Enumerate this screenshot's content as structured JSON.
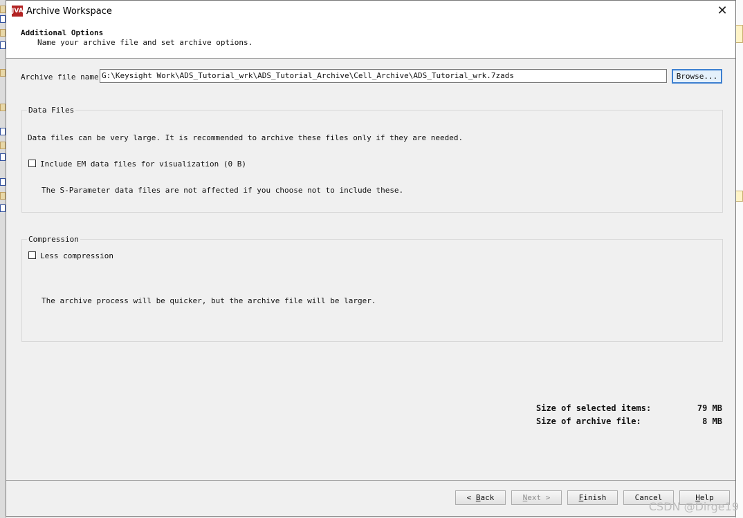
{
  "window": {
    "title": "Archive Workspace",
    "icon_text": "JVA",
    "close_glyph": "✕"
  },
  "header": {
    "title": "Additional Options",
    "subtitle": "Name your archive file and set archive options."
  },
  "archive": {
    "label": "Archive file name:",
    "value": "G:\\Keysight Work\\ADS_Tutorial_wrk\\ADS_Tutorial_Archive\\Cell_Archive\\ADS_Tutorial_wrk.7zads",
    "browse_label": "Browse..."
  },
  "data_files": {
    "group_title": "Data Files",
    "description": "Data files can be very large. It is recommended to archive these files only if they are needed.",
    "checkbox_label": "Include EM data files for visualization (0 B)",
    "checkbox_checked": false,
    "note": "The S-Parameter data files are not affected if you choose not to include these."
  },
  "compression": {
    "group_title": "Compression",
    "checkbox_label": "Less compression",
    "checkbox_checked": false,
    "note": "The archive process will be quicker, but the archive file will be larger."
  },
  "summary": {
    "selected_label": "Size of selected items:",
    "selected_value": "79 MB",
    "archive_label": "Size of archive file:",
    "archive_value": "8 MB"
  },
  "buttons": {
    "back": {
      "mnemonic": "B",
      "rest": "ack",
      "prefix": "< "
    },
    "next": {
      "mnemonic": "N",
      "rest": "ext",
      "suffix": " >"
    },
    "finish": {
      "mnemonic": "F",
      "rest": "inish"
    },
    "cancel": "Cancel",
    "help": {
      "mnemonic": "H",
      "rest": "elp"
    }
  },
  "watermark": "CSDN @Dirge19"
}
